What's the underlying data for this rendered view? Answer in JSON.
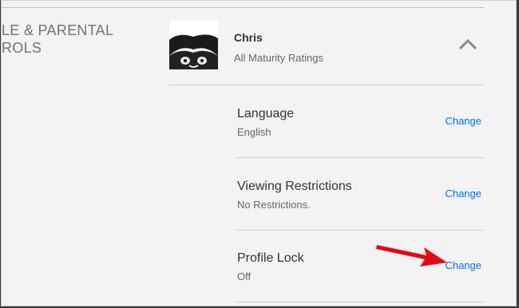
{
  "section": {
    "title_line1": "LE & PARENTAL",
    "title_line2": "ROLS"
  },
  "profile": {
    "name": "Chris",
    "maturity": "All Maturity Ratings"
  },
  "settings": [
    {
      "label": "Language",
      "value": "English",
      "action": "Change"
    },
    {
      "label": "Viewing Restrictions",
      "value": "No Restrictions.",
      "action": "Change"
    },
    {
      "label": "Profile Lock",
      "value": "Off",
      "action": "Change"
    }
  ],
  "colors": {
    "link": "#0071eb",
    "annotation_arrow": "#e50914"
  }
}
